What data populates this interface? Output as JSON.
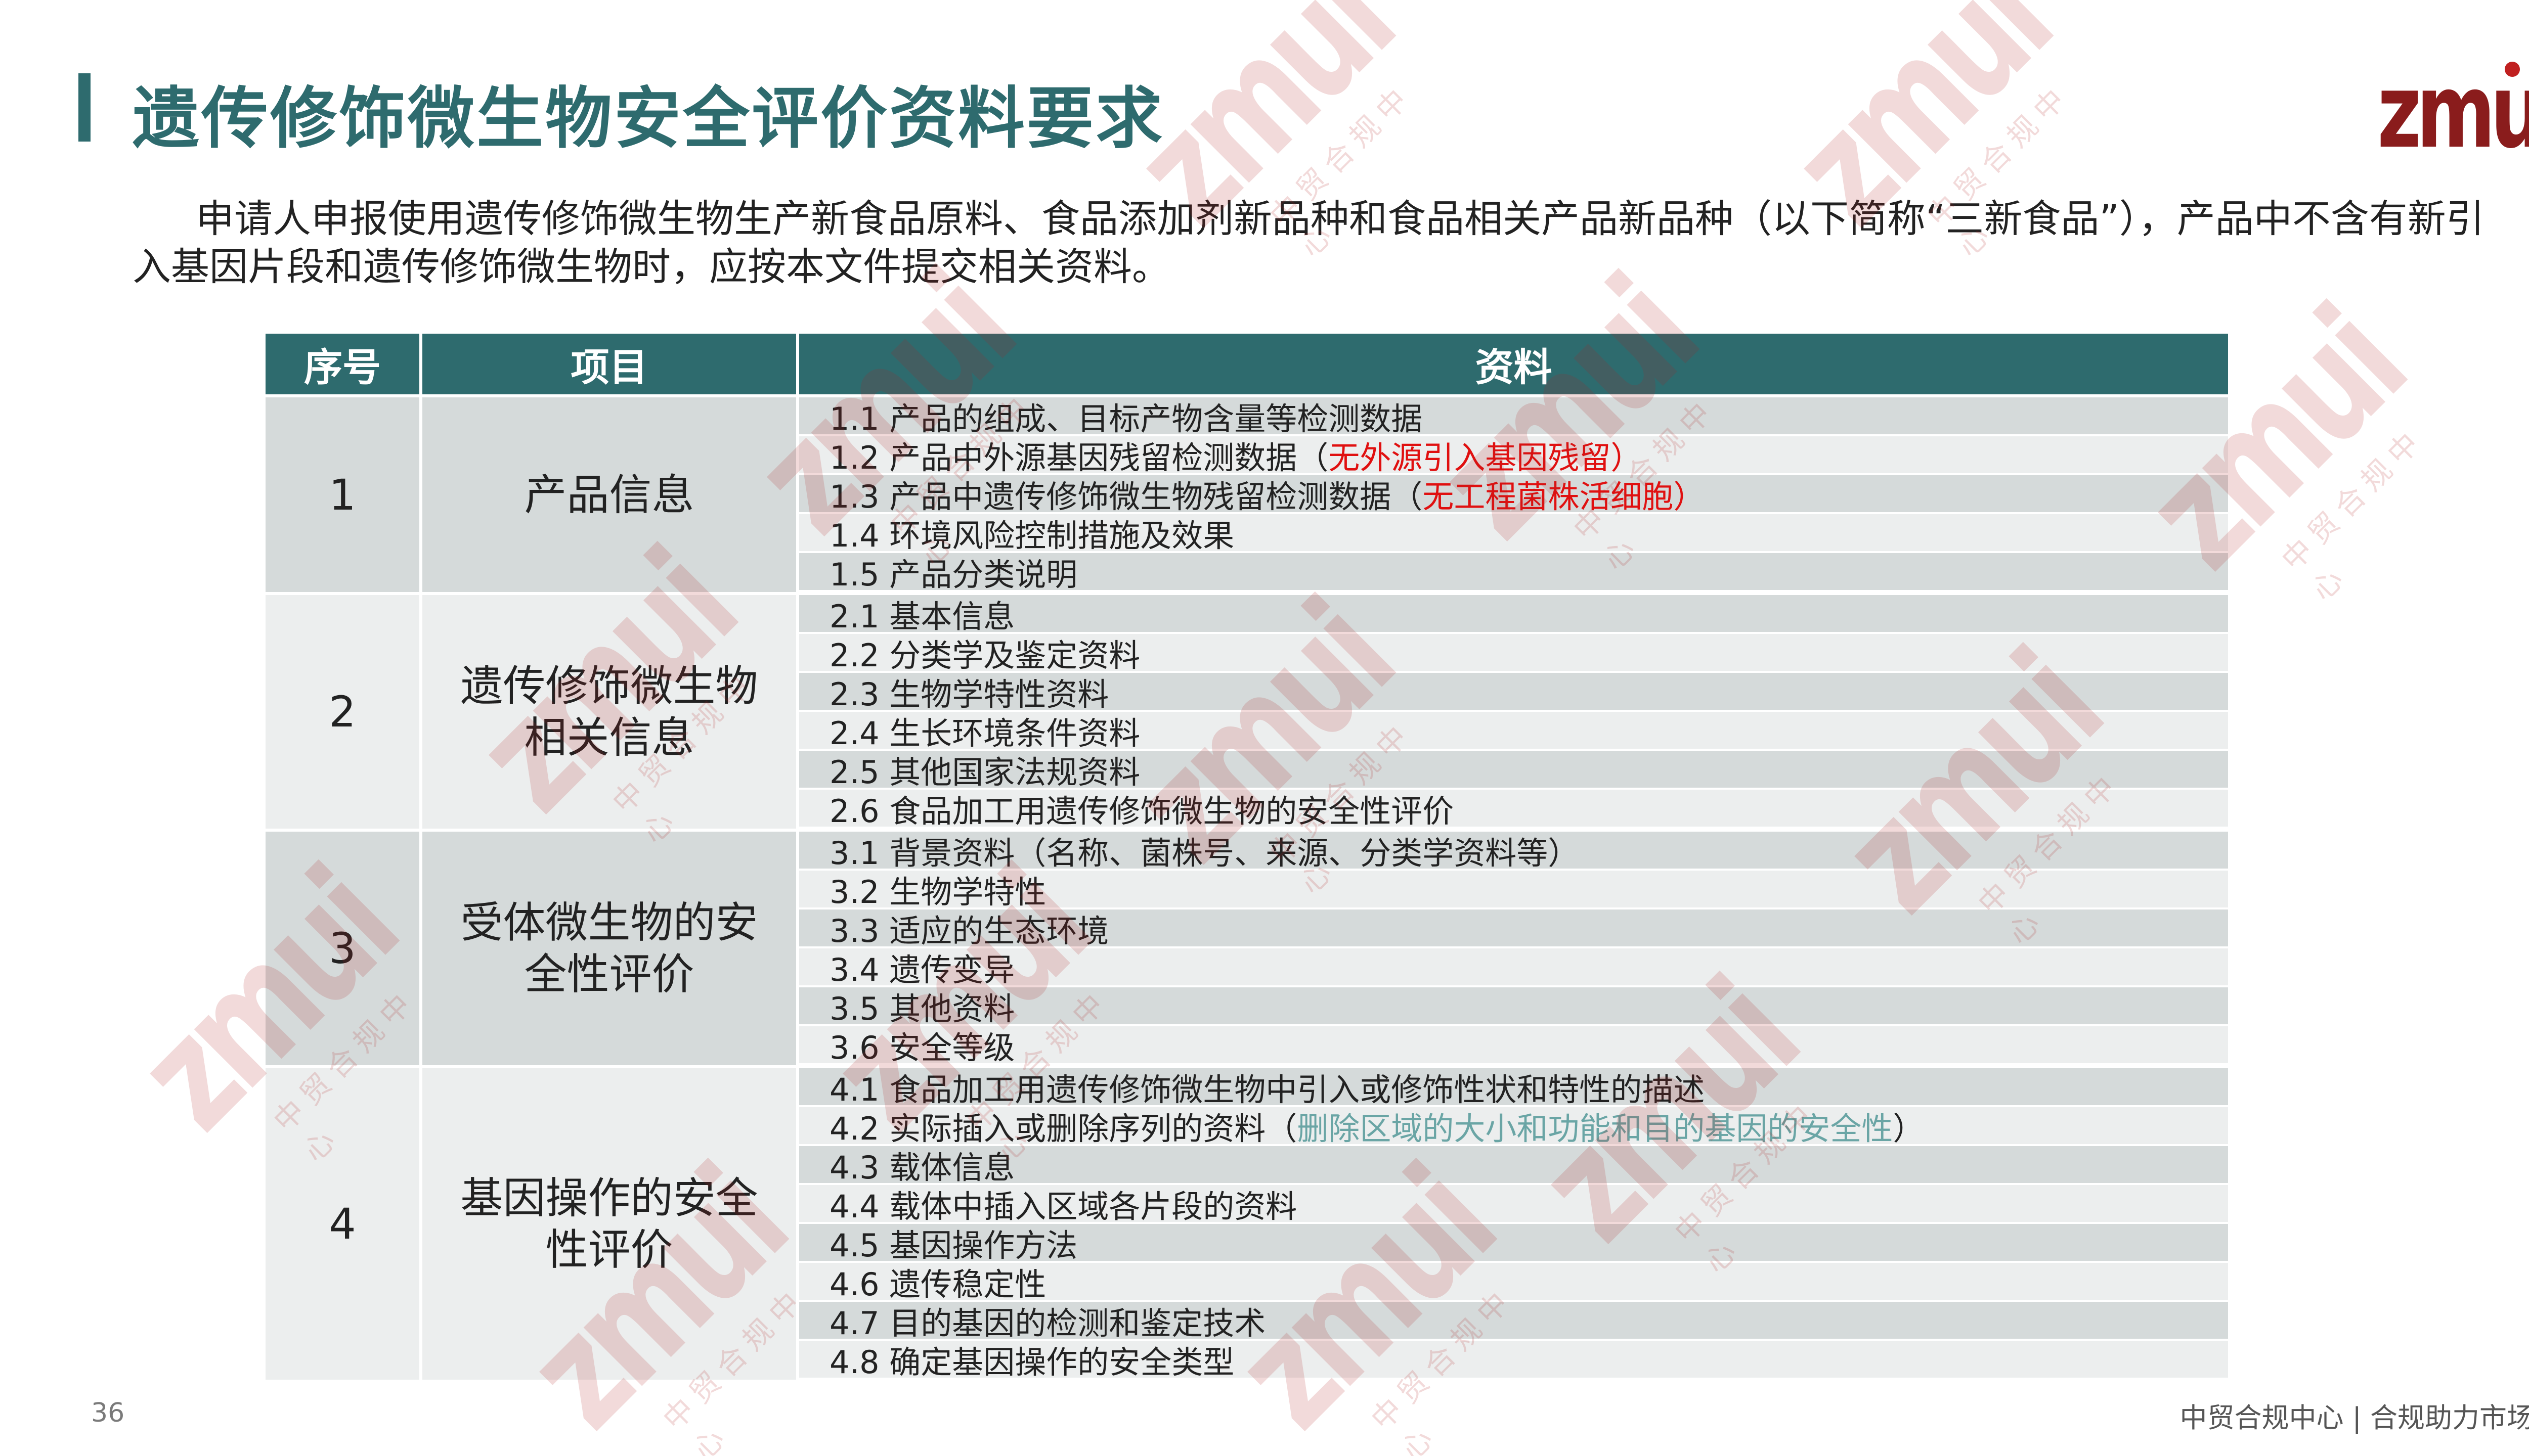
{
  "title": "遗传修饰微生物安全评价资料要求",
  "logo": {
    "text": "zmui"
  },
  "intro": "申请人申报使用遗传修饰微生物生产新食品原料、食品添加剂新品种和食品相关产品新品种（以下简称“三新食品”），产品中不含有新引入基因片段和遗传修饰微生物时，应按本文件提交相关资料。",
  "table": {
    "headers": [
      "序号",
      "项目",
      "资料"
    ],
    "groups": [
      {
        "seq": "1",
        "item": "产品信息",
        "rows": [
          {
            "text": "1.1 产品的组成、目标产物含量等检测数据",
            "note": ""
          },
          {
            "text": "1.2 产品中外源基因残留检测数据（",
            "note": "无外源引入基因残留）"
          },
          {
            "text": "1.3 产品中遗传修饰微生物残留检测数据（",
            "note": "无工程菌株活细胞）"
          },
          {
            "text": "1.4 环境风险控制措施及效果",
            "note": ""
          },
          {
            "text": "1.5 产品分类说明",
            "note": ""
          }
        ]
      },
      {
        "seq": "2",
        "item": "遗传修饰微生物相关信息",
        "rows": [
          {
            "text": "2.1 基本信息",
            "note": ""
          },
          {
            "text": "2.2 分类学及鉴定资料",
            "note": ""
          },
          {
            "text": "2.3 生物学特性资料",
            "note": ""
          },
          {
            "text": "2.4 生长环境条件资料",
            "note": ""
          },
          {
            "text": "2.5 其他国家法规资料",
            "note": ""
          },
          {
            "text": "2.6 食品加工用遗传修饰微生物的安全性评价",
            "note": ""
          }
        ]
      },
      {
        "seq": "3",
        "item": "受体微生物的安全性评价",
        "rows": [
          {
            "text": "3.1 背景资料（名称、菌株号、来源、分类学资料等）",
            "note": ""
          },
          {
            "text": "3.2 生物学特性",
            "note": ""
          },
          {
            "text": "3.3 适应的生态环境",
            "note": ""
          },
          {
            "text": "3.4 遗传变异",
            "note": ""
          },
          {
            "text": "3.5 其他资料",
            "note": ""
          },
          {
            "text": "3.6 安全等级",
            "note": ""
          }
        ]
      },
      {
        "seq": "4",
        "item": "基因操作的安全性评价",
        "rows": [
          {
            "text": "4.1 食品加工用遗传修饰微生物中引入或修饰性状和特性的描述",
            "note": ""
          },
          {
            "text": "4.2 实际插入或删除序列的资料（",
            "note": "删除区域的大小和功能和目的基因的安全性",
            "tail": "）"
          },
          {
            "text": "4.3 载体信息",
            "note": ""
          },
          {
            "text": "4.4 载体中插入区域各片段的资料",
            "note": ""
          },
          {
            "text": "4.5 基因操作方法",
            "note": ""
          },
          {
            "text": "4.6 遗传稳定性",
            "note": ""
          },
          {
            "text": "4.7 目的基因的检测和鉴定技术",
            "note": ""
          },
          {
            "text": "4.8 确定基因操作的安全类型",
            "note": ""
          }
        ]
      }
    ]
  },
  "page_number": "36",
  "footer": "中贸合规中心 | 合规助力市场",
  "watermark": {
    "brand": "zmui",
    "caption": "中贸合规中心"
  },
  "colors": {
    "accent": "#2e6b6e",
    "note_red": "#e01010",
    "note_teal": "#6aa5a5",
    "row_dark": "#d5dada",
    "row_light": "#eceeee"
  }
}
